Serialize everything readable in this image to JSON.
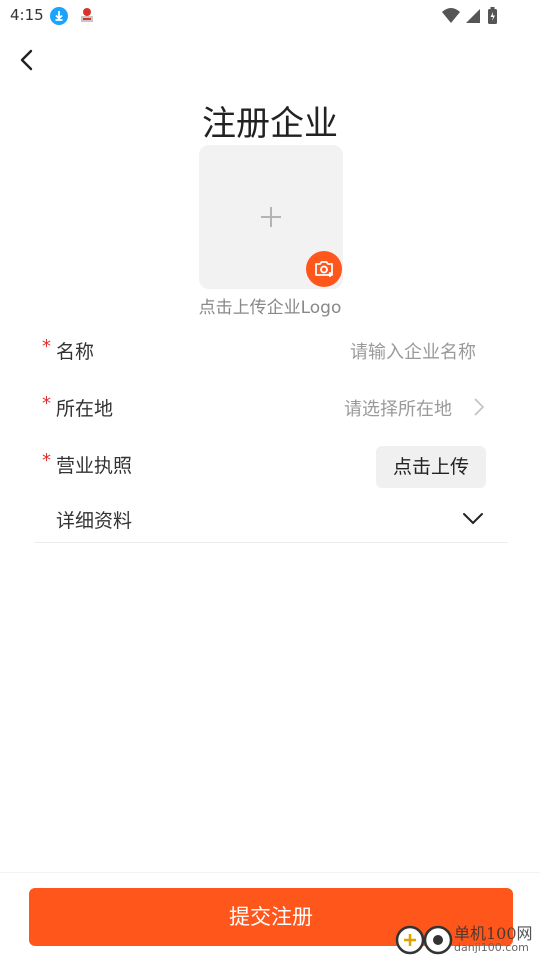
{
  "status": {
    "time": "4:15"
  },
  "header": {
    "title": "注册企业"
  },
  "logo": {
    "hint": "点击上传企业Logo"
  },
  "form": {
    "name": {
      "label": "名称",
      "placeholder": "请输入企业名称",
      "required": "*"
    },
    "location": {
      "label": "所在地",
      "placeholder": "请选择所在地",
      "required": "*"
    },
    "license": {
      "label": "营业执照",
      "button": "点击上传",
      "required": "*"
    },
    "details": {
      "label": "详细资料"
    }
  },
  "footer": {
    "submit_label": "提交注册"
  },
  "watermark": {
    "brand": "单机100网",
    "domain": "danji100.com"
  },
  "colors": {
    "accent": "#ff561c",
    "required": "#e03030",
    "placeholder": "#9a9a9a"
  }
}
